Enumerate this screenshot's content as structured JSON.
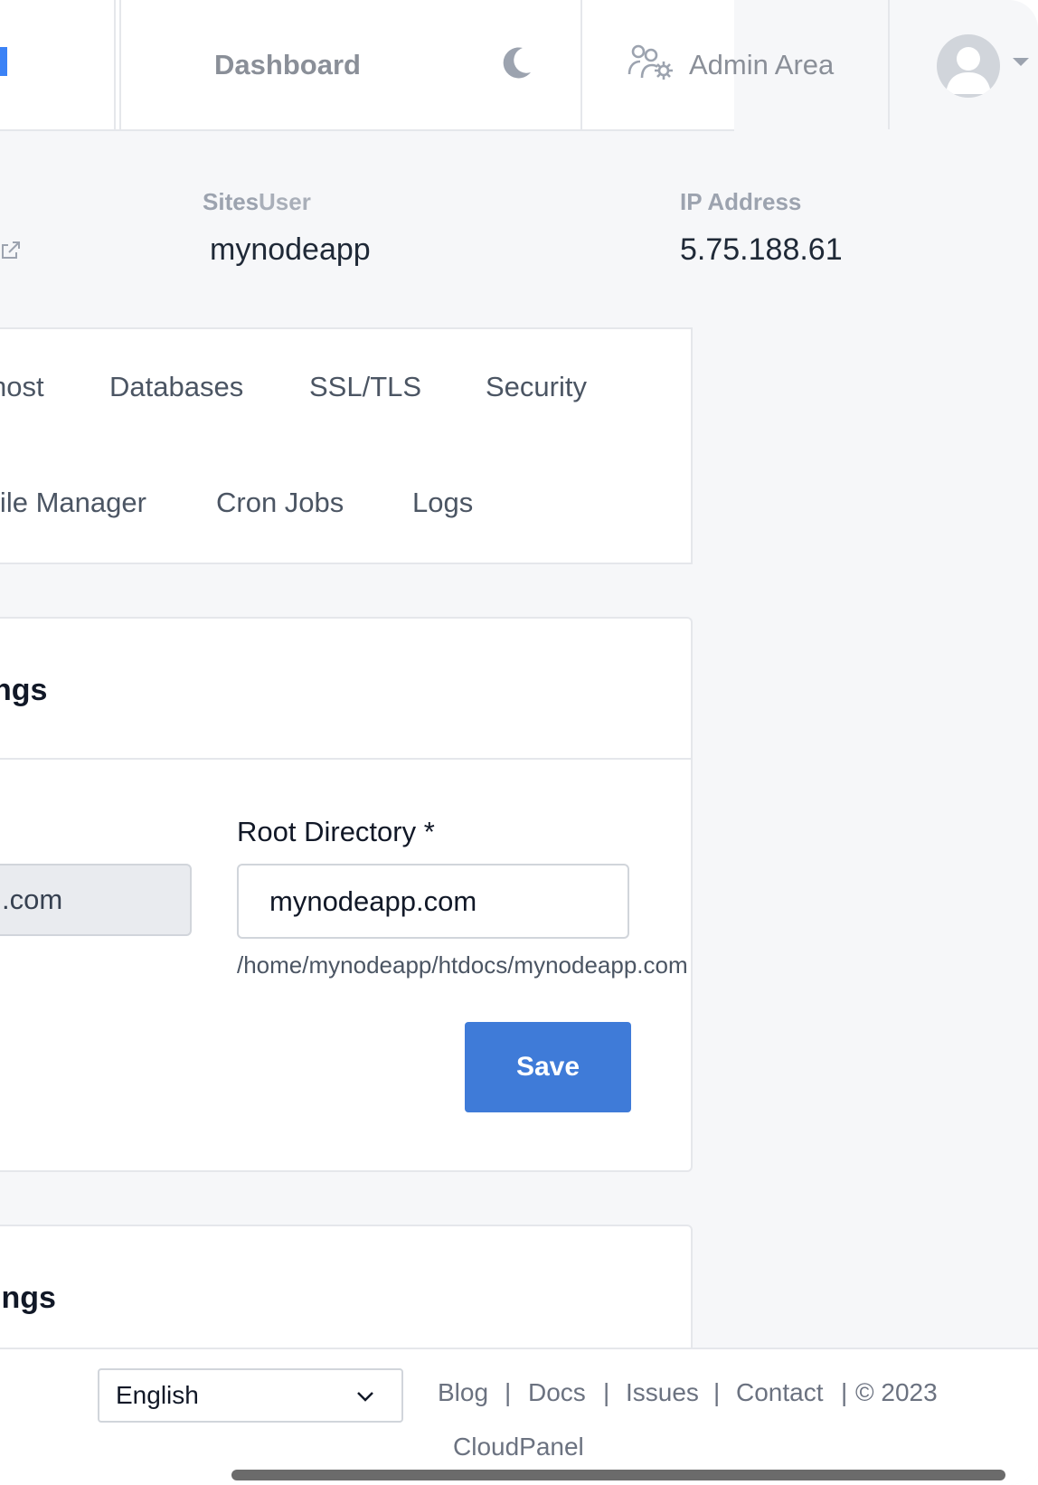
{
  "nav": {
    "dashboard": "Dashboard",
    "theme_icon": "moon-icon",
    "admin_icon": "users-gear-icon",
    "admin_area": "Admin Area",
    "avatar_icon": "user-avatar-icon"
  },
  "info": {
    "sites_label": "Sites",
    "user_label": "User",
    "user_value": "mynodeapp",
    "ip_label": "IP Address",
    "ip_value": "5.75.188.61"
  },
  "tabs": {
    "vhost": "host",
    "databases": "Databases",
    "ssl": "SSL/TLS",
    "security": "Security",
    "file_manager": "File Manager",
    "cron_jobs": "Cron Jobs",
    "logs": "Logs"
  },
  "settings_card": {
    "title": "ngs",
    "domain_value": ".com",
    "root_label": "Root Directory *",
    "root_value": "mynodeapp.com",
    "root_path": "/home/mynodeapp/htdocs/mynodeapp.com",
    "save": "Save"
  },
  "second_card": {
    "title": "ings"
  },
  "footer": {
    "language": "English",
    "links": [
      "Blog",
      "Docs",
      "Issues",
      "Contact"
    ],
    "copyright": "© 2023",
    "brand": "CloudPanel"
  },
  "colors": {
    "accent": "#3f7bd8",
    "background": "#f6f7f9",
    "border": "#e5e7eb"
  }
}
